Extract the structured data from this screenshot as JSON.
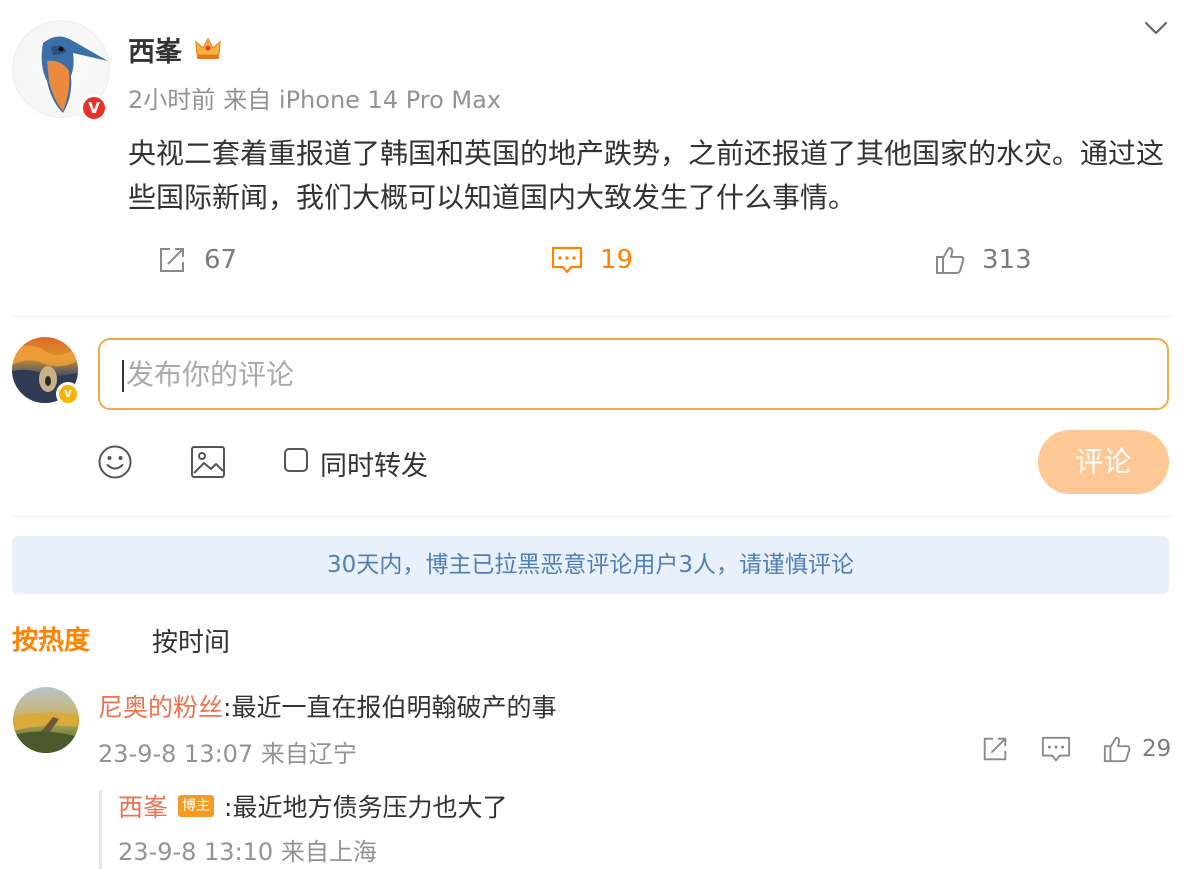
{
  "post": {
    "author": "西峯",
    "time": "2小时前",
    "source": "来自 iPhone 14 Pro Max",
    "text": "央视二套着重报道了韩国和英国的地产跌势，之前还报道了其他国家的水灾。通过这些国际新闻，我们大概可以知道国内大致发生了什么事情。",
    "verified_badge": "V",
    "actions": {
      "repost_count": "67",
      "comment_count": "19",
      "like_count": "313"
    }
  },
  "composer": {
    "placeholder": "发布你的评论",
    "repost_label": "同时转发",
    "submit_label": "评论"
  },
  "notice": "30天内，博主已拉黑恶意评论用户3人，请谨慎评论",
  "sort": {
    "hot": "按热度",
    "time": "按时间"
  },
  "comments": [
    {
      "user": "尼奥的粉丝",
      "text": ":最近一直在报伯明翰破产的事",
      "time": "23-9-8 13:07",
      "location": "来自辽宁",
      "likes": "29",
      "reply": {
        "user": "西峯",
        "badge": "博主",
        "text": ":最近地方债务压力也大了",
        "time": "23-9-8 13:10",
        "location": "来自上海"
      }
    }
  ],
  "colors": {
    "accent": "#ff8200",
    "username": "#eb7350",
    "notice_bg": "#e8f1fb",
    "notice_text": "#4f7fb5",
    "submit_bg": "#fdc796"
  }
}
